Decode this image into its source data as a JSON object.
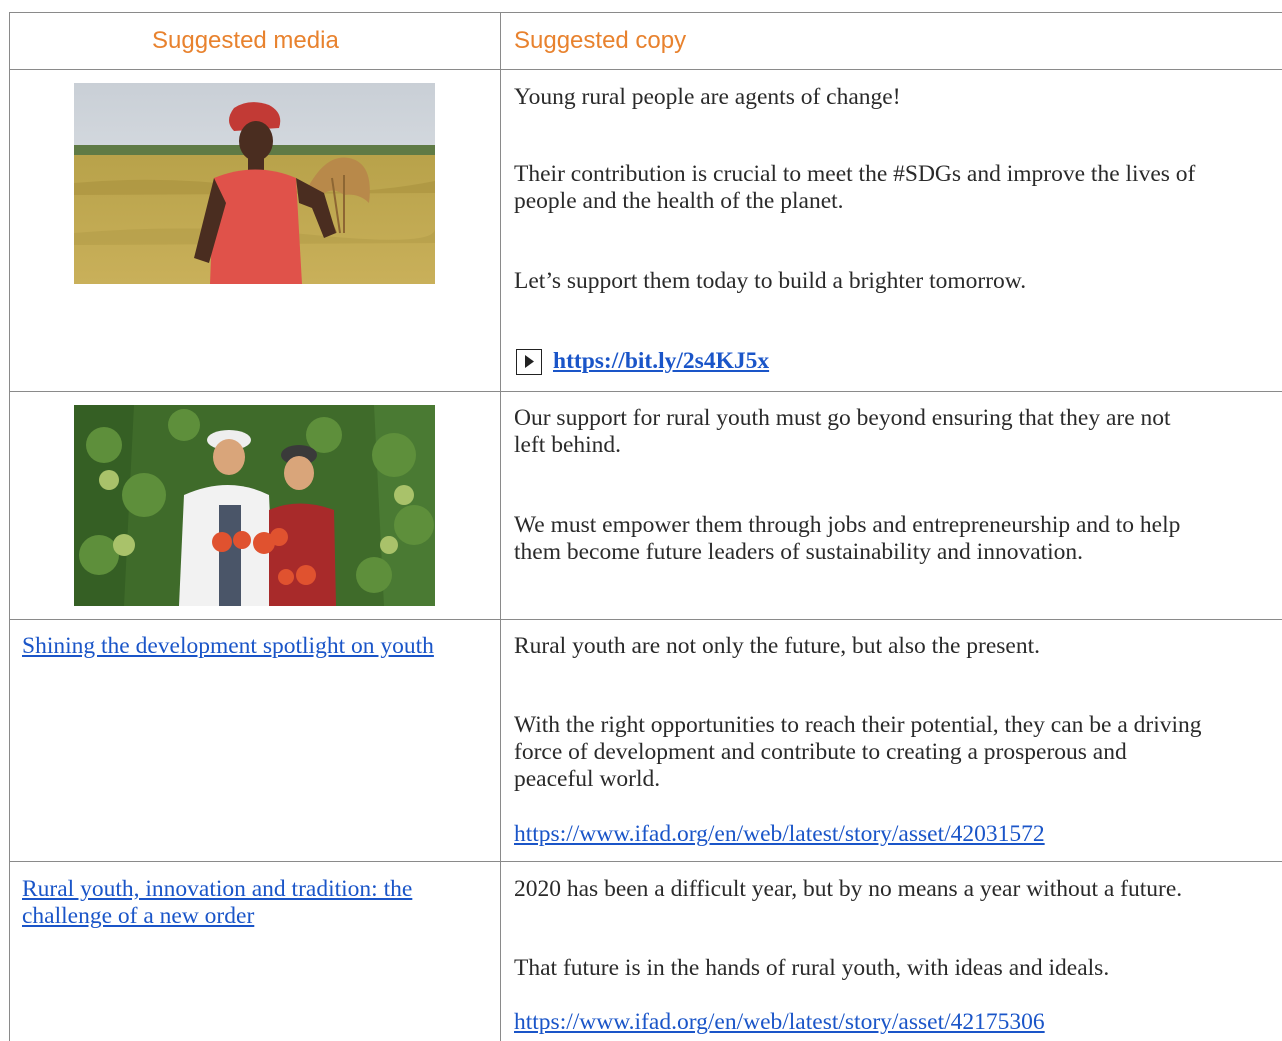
{
  "header": {
    "media_label": "Suggested media",
    "copy_label": "Suggested copy"
  },
  "rows": [
    {
      "media": {
        "image": "woman-holding-rice-in-field-photo"
      },
      "copy": [
        "Young rural people are agents of change!",
        "Their contribution is crucial to meet the #SDGs and improve the lives of",
        "people and the health of the planet.",
        "Let’s support them today to build a brighter tomorrow."
      ],
      "link": {
        "icon": "play-icon",
        "text": "https://bit.ly/2s4KJ5x"
      }
    },
    {
      "media": {
        "image": "two-people-holding-tomatoes-greenhouse-photo"
      },
      "copy": [
        "Our support for rural youth must go beyond ensuring that they are not",
        "left behind.",
        "We must empower them through jobs and entrepreneurship and to help",
        "them become future leaders of sustainability and innovation."
      ]
    },
    {
      "media": {
        "link_lines": [
          "Shining the development spotlight on youth"
        ]
      },
      "copy": [
        "Rural youth are not only the future, but also the present.",
        "With the right opportunities to reach their potential, they can be a driving",
        "force of development and contribute to creating a prosperous and",
        "peaceful world."
      ],
      "link": {
        "text": "https://www.ifad.org/en/web/latest/story/asset/42031572"
      }
    },
    {
      "media": {
        "link_lines": [
          "Rural youth, innovation and tradition: the",
          "challenge of a new order"
        ]
      },
      "copy": [
        "2020 has been a difficult year, but by no means a year without a future.",
        "That future is in the hands of rural youth, with ideas and ideals."
      ],
      "link": {
        "text": "https://www.ifad.org/en/web/latest/story/asset/42175306"
      }
    }
  ],
  "colors": {
    "header_orange": "#e8822e",
    "link_blue": "#1a55c8",
    "grid": "#8a8a8a"
  }
}
